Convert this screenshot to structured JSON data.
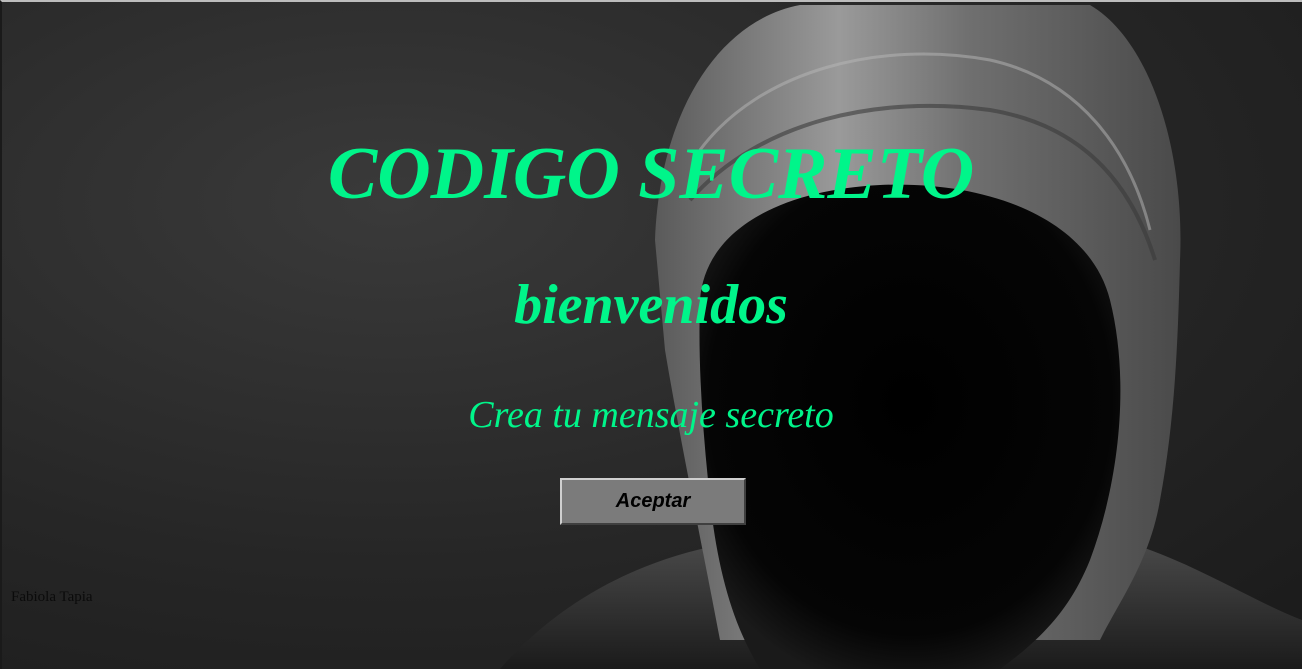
{
  "header": {
    "title": "CODIGO SECRETO",
    "subtitle": "bienvenidos",
    "tagline": "Crea tu mensaje secreto"
  },
  "actions": {
    "accept_label": "Aceptar"
  },
  "footer": {
    "author": "Fabiola Tapia"
  },
  "colors": {
    "accent": "#00f58a",
    "button_bg": "#7b7b7b",
    "background": "#2a2a2a"
  },
  "background_image": {
    "subject": "hooded-figure"
  }
}
